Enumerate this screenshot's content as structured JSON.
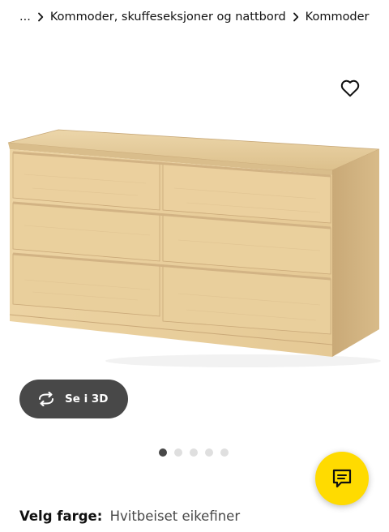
{
  "breadcrumb": {
    "items": [
      {
        "label": "..."
      },
      {
        "label": "Kommoder, skuffeseksjoner og nattbord"
      },
      {
        "label": "Kommoder"
      }
    ]
  },
  "icons": {
    "separator": "chevron-right-icon",
    "favourite": "heart-outline-icon",
    "rotate_3d": "rotate-arrows-icon",
    "chat": "chat-bubble-icon"
  },
  "product_image": {
    "alt": "Kommode med 6 skuffer"
  },
  "view_3d": {
    "label": "Se i 3D"
  },
  "carousel": {
    "total": 5,
    "active_index": 0
  },
  "color_select": {
    "label": "Velg farge:",
    "value": "Hvitbeiset eikefiner"
  },
  "colors": {
    "text": "#111111",
    "button_dark": "#484848",
    "dot_inactive": "#dfdfdf",
    "chat_yellow": "#ffdb00",
    "wood": "#e9cf9e"
  }
}
